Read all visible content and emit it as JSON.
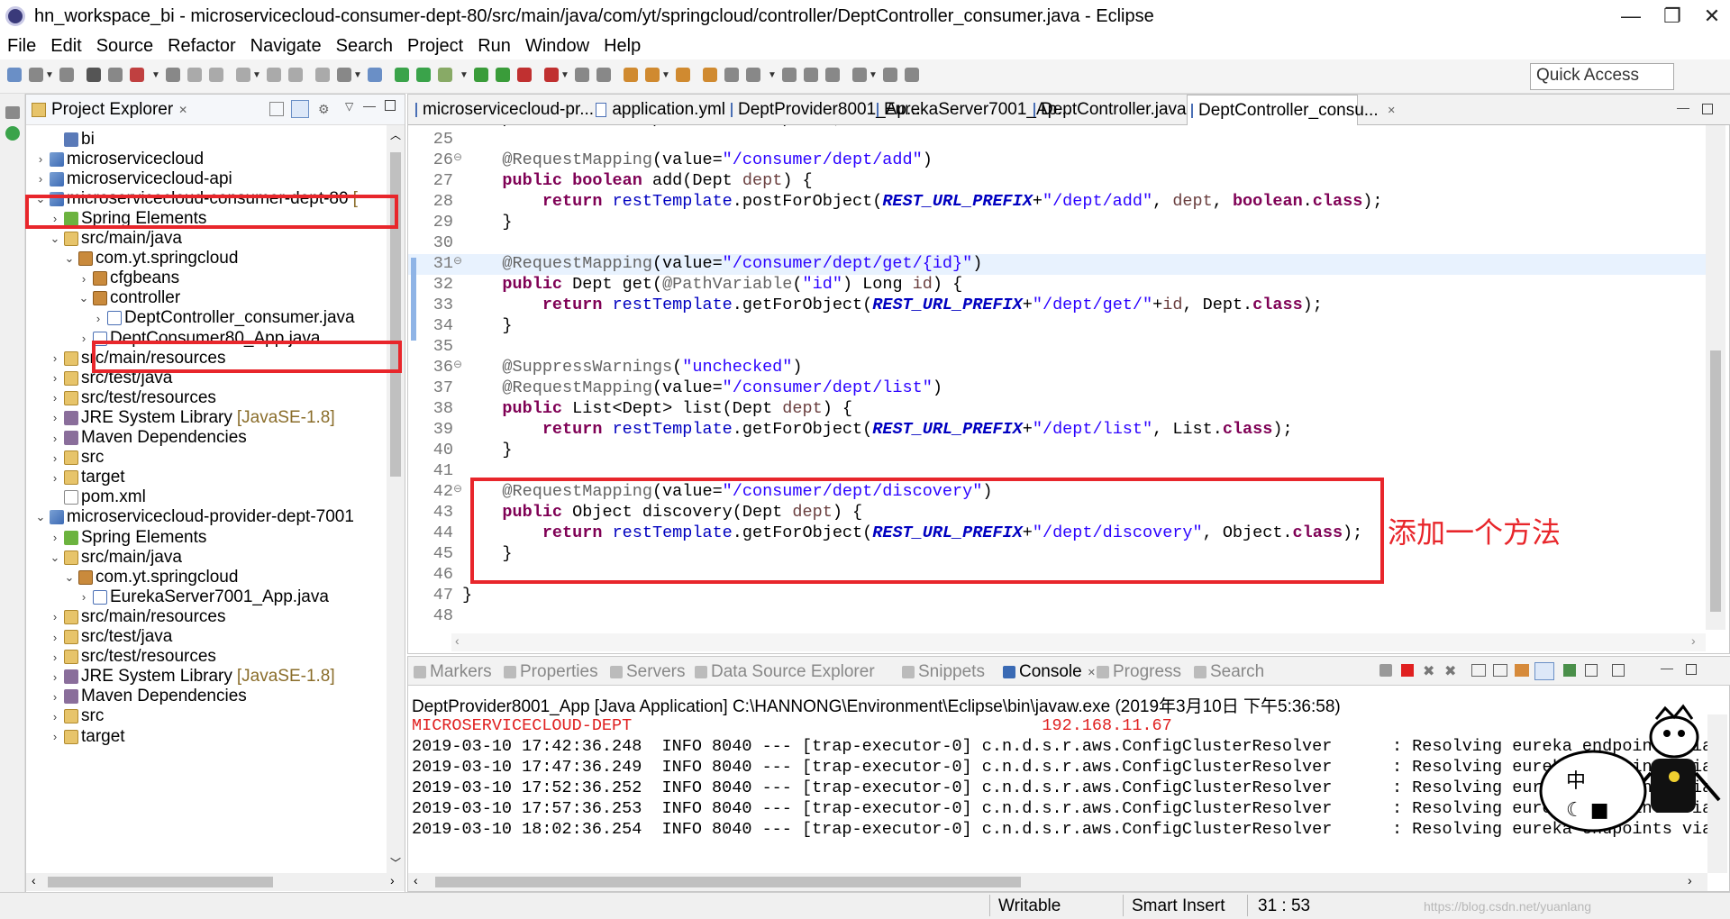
{
  "window": {
    "title": "hn_workspace_bi - microservicecloud-consumer-dept-80/src/main/java/com/yt/springcloud/controller/DeptController_consumer.java - Eclipse",
    "minimize": "—",
    "maximize": "❐",
    "close": "✕"
  },
  "menu": [
    "File",
    "Edit",
    "Source",
    "Refactor",
    "Navigate",
    "Search",
    "Project",
    "Run",
    "Window",
    "Help"
  ],
  "toolbar": {
    "quick_access": "Quick Access"
  },
  "explorer": {
    "title": "Project Explorer",
    "close": "✕",
    "items": [
      {
        "label": "bi",
        "icon": "bi",
        "twisty": ""
      },
      {
        "label": "microservicecloud",
        "icon": "proj",
        "twisty": "›"
      },
      {
        "label": "microservicecloud-api",
        "icon": "proj",
        "twisty": "›"
      },
      {
        "label": "microservicecloud-consumer-dept-80",
        "icon": "proj",
        "twisty": "⌄",
        "decor": "["
      },
      {
        "label": "Spring Elements",
        "icon": "spring",
        "twisty": "›"
      },
      {
        "label": "src/main/java",
        "icon": "folder",
        "twisty": "⌄"
      },
      {
        "label": "com.yt.springcloud",
        "icon": "pkg",
        "twisty": "⌄"
      },
      {
        "label": "cfgbeans",
        "icon": "pkg",
        "twisty": "›"
      },
      {
        "label": "controller",
        "icon": "pkg",
        "twisty": "⌄"
      },
      {
        "label": "DeptController_consumer.java",
        "icon": "java",
        "twisty": "›"
      },
      {
        "label": "DeptConsumer80_App.java",
        "icon": "java",
        "twisty": "›"
      },
      {
        "label": "src/main/resources",
        "icon": "folder",
        "twisty": "›"
      },
      {
        "label": "src/test/java",
        "icon": "folder",
        "twisty": "›"
      },
      {
        "label": "src/test/resources",
        "icon": "folder",
        "twisty": "›"
      },
      {
        "label": "JRE System Library",
        "icon": "lib",
        "twisty": "›",
        "decor": "[JavaSE-1.8]"
      },
      {
        "label": "Maven Dependencies",
        "icon": "lib",
        "twisty": "›"
      },
      {
        "label": "src",
        "icon": "folder",
        "twisty": "›"
      },
      {
        "label": "target",
        "icon": "folder",
        "twisty": "›"
      },
      {
        "label": "pom.xml",
        "icon": "xml",
        "twisty": ""
      },
      {
        "label": "microservicecloud-provider-dept-7001",
        "icon": "proj",
        "twisty": "⌄"
      },
      {
        "label": "Spring Elements",
        "icon": "spring",
        "twisty": "›"
      },
      {
        "label": "src/main/java",
        "icon": "folder",
        "twisty": "⌄"
      },
      {
        "label": "com.yt.springcloud",
        "icon": "pkg",
        "twisty": "⌄"
      },
      {
        "label": "EurekaServer7001_App.java",
        "icon": "java",
        "twisty": "›"
      },
      {
        "label": "src/main/resources",
        "icon": "folder",
        "twisty": "›"
      },
      {
        "label": "src/test/java",
        "icon": "folder",
        "twisty": "›"
      },
      {
        "label": "src/test/resources",
        "icon": "folder",
        "twisty": "›"
      },
      {
        "label": "JRE System Library",
        "icon": "lib",
        "twisty": "›",
        "decor": "[JavaSE-1.8]"
      },
      {
        "label": "Maven Dependencies",
        "icon": "lib",
        "twisty": "›"
      },
      {
        "label": "src",
        "icon": "folder",
        "twisty": "›"
      },
      {
        "label": "target",
        "icon": "folder",
        "twisty": "›"
      }
    ]
  },
  "editor": {
    "tabs": [
      {
        "label": "microservicecloud-pr...",
        "active": false
      },
      {
        "label": "application.yml",
        "active": false
      },
      {
        "label": "DeptProvider8001_Ap...",
        "active": false
      },
      {
        "label": "EurekaServer7001_Ap...",
        "active": false
      },
      {
        "label": "DeptController.java",
        "active": false
      },
      {
        "label": "DeptController_consu...",
        "active": true
      }
    ],
    "lines": [
      {
        "n": "24",
        "fold": "",
        "tokens": [
          [
            "t",
            "\tprivate RestTemplate restTemplate;"
          ]
        ]
      },
      {
        "n": "25",
        "fold": "",
        "tokens": []
      },
      {
        "n": "26",
        "fold": "⊖",
        "tokens": [
          [
            "ann",
            "\t@RequestMapping"
          ],
          [
            "t",
            "(value="
          ],
          [
            "str",
            "\"/consumer/dept/add\""
          ],
          [
            "t",
            ")"
          ]
        ]
      },
      {
        "n": "27",
        "fold": "",
        "tokens": [
          [
            "kw",
            "\tpublic boolean"
          ],
          [
            "t",
            " add(Dept "
          ],
          [
            "prm",
            "dept"
          ],
          [
            "t",
            ") {"
          ]
        ]
      },
      {
        "n": "28",
        "fold": "",
        "tokens": [
          [
            "kw",
            "\t\treturn"
          ],
          [
            "t",
            " "
          ],
          [
            "fld",
            "restTemplate"
          ],
          [
            "t",
            ".postForObject("
          ],
          [
            "cst",
            "REST_URL_PREFIX"
          ],
          [
            "t",
            "+"
          ],
          [
            "str",
            "\"/dept/add\""
          ],
          [
            "t",
            ", "
          ],
          [
            "prm",
            "dept"
          ],
          [
            "t",
            ", "
          ],
          [
            "kw",
            "boolean"
          ],
          [
            "t",
            "."
          ],
          [
            "kw",
            "class"
          ],
          [
            "t",
            ");"
          ]
        ]
      },
      {
        "n": "29",
        "fold": "",
        "tokens": [
          [
            "t",
            "\t}"
          ]
        ]
      },
      {
        "n": "30",
        "fold": "",
        "tokens": []
      },
      {
        "n": "31",
        "fold": "⊖",
        "hl": true,
        "tokens": [
          [
            "ann",
            "\t@RequestMapping"
          ],
          [
            "t",
            "(value="
          ],
          [
            "str",
            "\"/consumer/dept/get/{id}\""
          ],
          [
            "t",
            ")"
          ]
        ]
      },
      {
        "n": "32",
        "fold": "",
        "tokens": [
          [
            "kw",
            "\tpublic"
          ],
          [
            "t",
            " Dept get("
          ],
          [
            "ann",
            "@PathVariable"
          ],
          [
            "t",
            "("
          ],
          [
            "str",
            "\"id\""
          ],
          [
            "t",
            ") Long "
          ],
          [
            "prm",
            "id"
          ],
          [
            "t",
            ") {"
          ]
        ]
      },
      {
        "n": "33",
        "fold": "",
        "tokens": [
          [
            "kw",
            "\t\treturn"
          ],
          [
            "t",
            " "
          ],
          [
            "fld",
            "restTemplate"
          ],
          [
            "t",
            ".getForObject("
          ],
          [
            "cst",
            "REST_URL_PREFIX"
          ],
          [
            "t",
            "+"
          ],
          [
            "str",
            "\"/dept/get/\""
          ],
          [
            "t",
            "+"
          ],
          [
            "prm",
            "id"
          ],
          [
            "t",
            ", Dept."
          ],
          [
            "kw",
            "class"
          ],
          [
            "t",
            ");"
          ]
        ]
      },
      {
        "n": "34",
        "fold": "",
        "tokens": [
          [
            "t",
            "\t}"
          ]
        ]
      },
      {
        "n": "35",
        "fold": "",
        "tokens": []
      },
      {
        "n": "36",
        "fold": "⊖",
        "tokens": [
          [
            "ann",
            "\t@SuppressWarnings"
          ],
          [
            "t",
            "("
          ],
          [
            "str",
            "\"unchecked\""
          ],
          [
            "t",
            ")"
          ]
        ]
      },
      {
        "n": "37",
        "fold": "",
        "tokens": [
          [
            "ann",
            "\t@RequestMapping"
          ],
          [
            "t",
            "(value="
          ],
          [
            "str",
            "\"/consumer/dept/list\""
          ],
          [
            "t",
            ")"
          ]
        ]
      },
      {
        "n": "38",
        "fold": "",
        "tokens": [
          [
            "kw",
            "\tpublic"
          ],
          [
            "t",
            " List<Dept> list(Dept "
          ],
          [
            "prm",
            "dept"
          ],
          [
            "t",
            ") {"
          ]
        ]
      },
      {
        "n": "39",
        "fold": "",
        "tokens": [
          [
            "kw",
            "\t\treturn"
          ],
          [
            "t",
            " "
          ],
          [
            "fld",
            "restTemplate"
          ],
          [
            "t",
            ".getForObject("
          ],
          [
            "cst",
            "REST_URL_PREFIX"
          ],
          [
            "t",
            "+"
          ],
          [
            "str",
            "\"/dept/list\""
          ],
          [
            "t",
            ", List."
          ],
          [
            "kw",
            "class"
          ],
          [
            "t",
            ");"
          ]
        ]
      },
      {
        "n": "40",
        "fold": "",
        "tokens": [
          [
            "t",
            "\t}"
          ]
        ]
      },
      {
        "n": "41",
        "fold": "",
        "tokens": []
      },
      {
        "n": "42",
        "fold": "⊖",
        "tokens": [
          [
            "ann",
            "\t@RequestMapping"
          ],
          [
            "t",
            "(value="
          ],
          [
            "str",
            "\"/consumer/dept/discovery\""
          ],
          [
            "t",
            ")"
          ]
        ]
      },
      {
        "n": "43",
        "fold": "",
        "tokens": [
          [
            "kw",
            "\tpublic"
          ],
          [
            "t",
            " Object discovery(Dept "
          ],
          [
            "prm",
            "dept"
          ],
          [
            "t",
            ") {"
          ]
        ]
      },
      {
        "n": "44",
        "fold": "",
        "tokens": [
          [
            "kw",
            "\t\treturn"
          ],
          [
            "t",
            " "
          ],
          [
            "fld",
            "restTemplate"
          ],
          [
            "t",
            ".getForObject("
          ],
          [
            "cst",
            "REST_URL_PREFIX"
          ],
          [
            "t",
            "+"
          ],
          [
            "str",
            "\"/dept/discovery\""
          ],
          [
            "t",
            ", Object."
          ],
          [
            "kw",
            "class"
          ],
          [
            "t",
            ");"
          ]
        ]
      },
      {
        "n": "45",
        "fold": "",
        "tokens": [
          [
            "t",
            "\t}"
          ]
        ]
      },
      {
        "n": "46",
        "fold": "",
        "tokens": []
      },
      {
        "n": "47",
        "fold": "",
        "tokens": [
          [
            "t",
            "}"
          ]
        ]
      },
      {
        "n": "48",
        "fold": "",
        "tokens": []
      }
    ]
  },
  "annotation": "添加一个方法",
  "console": {
    "tabs": [
      "Markers",
      "Properties",
      "Servers",
      "Data Source Explorer",
      "Snippets",
      "Console",
      "Progress",
      "Search"
    ],
    "active_tab": "Console",
    "header": "DeptProvider8001_App [Java Application] C:\\HANNONG\\Environment\\Eclipse\\bin\\javaw.exe (2019年3月10日 下午5:36:58)",
    "lines": [
      {
        "text": "MICROSERVICECLOUD-DEPT                                         192.168.11.67",
        "err": true
      },
      {
        "text": "2019-03-10 17:42:36.248  INFO 8040 --- [trap-executor-0] c.n.d.s.r.aws.ConfigClusterResolver      : Resolving eureka endpoints via",
        "err": false
      },
      {
        "text": "2019-03-10 17:47:36.249  INFO 8040 --- [trap-executor-0] c.n.d.s.r.aws.ConfigClusterResolver      : Resolving eureka endpoints via",
        "err": false
      },
      {
        "text": "2019-03-10 17:52:36.252  INFO 8040 --- [trap-executor-0] c.n.d.s.r.aws.ConfigClusterResolver      : Resolving eureka endpoints via",
        "err": false
      },
      {
        "text": "2019-03-10 17:57:36.253  INFO 8040 --- [trap-executor-0] c.n.d.s.r.aws.ConfigClusterResolver      : Resolving eureka endpoints via",
        "err": false
      },
      {
        "text": "2019-03-10 18:02:36.254  INFO 8040 --- [trap-executor-0] c.n.d.s.r.aws.ConfigClusterResolver      : Resolving eureka endpoints via",
        "err": false
      }
    ]
  },
  "status": {
    "writable": "Writable",
    "insert_mode": "Smart Insert",
    "position": "31 : 53"
  },
  "watermark": "https://blog.csdn.net/yuanlang",
  "colors": {
    "highlight_box": "#e8262b",
    "keyword": "#7f0055",
    "string": "#2a00ff",
    "field": "#0000c0",
    "annotation": "#646464"
  }
}
